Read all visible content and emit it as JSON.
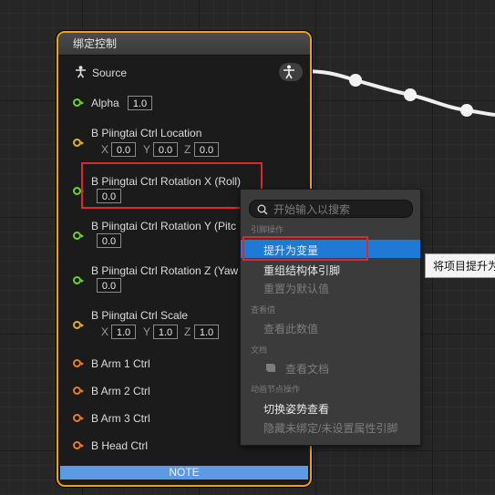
{
  "node": {
    "title": "绑定控制",
    "source_label": "Source",
    "alpha_label": "Alpha",
    "alpha_value": "1.0",
    "location_label": "B Piingtai Ctrl Location",
    "location": {
      "x_label": "X",
      "x": "0.0",
      "y_label": "Y",
      "y": "0.0",
      "z_label": "Z",
      "z": "0.0"
    },
    "rot_x_label": "B Piingtai Ctrl Rotation X (Roll)",
    "rot_x_value": "0.0",
    "rot_y_label": "B Piingtai Ctrl Rotation Y (Pitc",
    "rot_y_value": "0.0",
    "rot_z_label": "B Piingtai Ctrl Rotation Z (Yaw",
    "rot_z_value": "0.0",
    "scale_label": "B Piingtai Ctrl Scale",
    "scale": {
      "x_label": "X",
      "x": "1.0",
      "y_label": "Y",
      "y": "1.0",
      "z_label": "Z",
      "z": "1.0"
    },
    "arm1": "B Arm 1 Ctrl",
    "arm2": "B Arm 2 Ctrl",
    "arm3": "B Arm 3 Ctrl",
    "head": "B Head Ctrl",
    "note": "NOTE"
  },
  "context_menu": {
    "search_placeholder": "开始输入以搜索",
    "section_pin": "引脚操作",
    "promote": "提升为变量",
    "split_struct": "重组结构体引脚",
    "reset_default": "重置为默认值",
    "section_view": "查看值",
    "view_value": "查看此数值",
    "section_docs": "文档",
    "view_docs": "查看文档",
    "section_anim": "动画节点操作",
    "toggle_pose": "切换姿势查看",
    "hide_unbound": "隐藏未绑定/未设置属性引脚"
  },
  "tooltip": "将项目提升为"
}
